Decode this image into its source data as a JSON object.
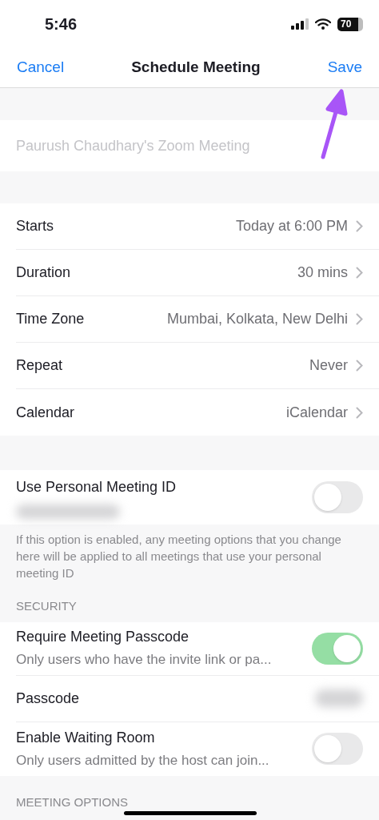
{
  "status_bar": {
    "time": "5:46",
    "battery": "70"
  },
  "nav": {
    "cancel": "Cancel",
    "title": "Schedule Meeting",
    "save": "Save"
  },
  "topic": {
    "placeholder": "Paurush Chaudhary's Zoom Meeting"
  },
  "settings": [
    {
      "label": "Starts",
      "value": "Today at 6:00 PM"
    },
    {
      "label": "Duration",
      "value": "30 mins"
    },
    {
      "label": "Time Zone",
      "value": "Mumbai, Kolkata, New Delhi"
    },
    {
      "label": "Repeat",
      "value": "Never"
    },
    {
      "label": "Calendar",
      "value": "iCalendar"
    }
  ],
  "personal_id": {
    "label": "Use Personal Meeting ID",
    "on": false,
    "note": "If this option is enabled, any meeting options that you change here will be applied to all meetings that use your personal meeting ID"
  },
  "security": {
    "heading": "SECURITY",
    "rows": [
      {
        "kind": "toggle",
        "label": "Require Meeting Passcode",
        "detail": "Only users who have the invite link or pa...",
        "on": true
      },
      {
        "kind": "hidden",
        "label": "Passcode"
      },
      {
        "kind": "toggle",
        "label": "Enable Waiting Room",
        "detail": "Only users admitted by the host can join...",
        "on": false
      }
    ]
  },
  "meeting_options": {
    "heading": "MEETING OPTIONS"
  }
}
